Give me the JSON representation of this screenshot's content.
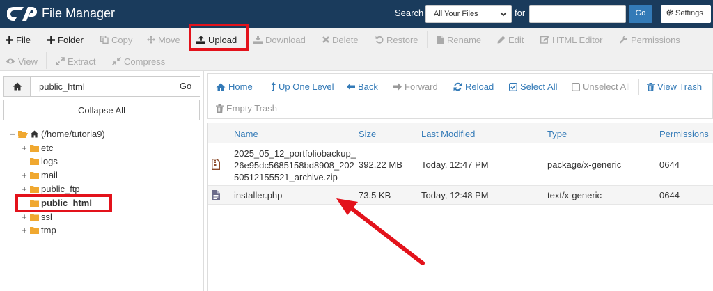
{
  "header": {
    "title": "File Manager",
    "search_label": "Search",
    "search_scope": "All Your Files",
    "for_label": "for",
    "search_value": "",
    "go_label": "Go",
    "settings_label": "Settings"
  },
  "toolbar": {
    "file": "File",
    "folder": "Folder",
    "copy": "Copy",
    "move": "Move",
    "upload": "Upload",
    "download": "Download",
    "delete": "Delete",
    "restore": "Restore",
    "rename": "Rename",
    "edit": "Edit",
    "html_editor": "HTML Editor",
    "permissions": "Permissions",
    "view": "View",
    "extract": "Extract",
    "compress": "Compress"
  },
  "sidebar": {
    "path_value": "public_html",
    "go_label": "Go",
    "collapse_label": "Collapse All",
    "root_label": "(/home/tutoria9)",
    "folders": [
      "etc",
      "logs",
      "mail",
      "public_ftp",
      "public_html",
      "ssl",
      "tmp"
    ]
  },
  "nav": {
    "home": "Home",
    "up_one_level": "Up One Level",
    "back": "Back",
    "forward": "Forward",
    "reload": "Reload",
    "select_all": "Select All",
    "unselect_all": "Unselect All",
    "view_trash": "View Trash",
    "empty_trash": "Empty Trash"
  },
  "table": {
    "columns": [
      "Name",
      "Size",
      "Last Modified",
      "Type",
      "Permissions"
    ],
    "rows": [
      {
        "name_lines": [
          "2025_05_12_portfoliobackup_",
          "26e95dc5685158bd8908_202",
          "50512155521_archive.zip"
        ],
        "size": "392.22 MB",
        "modified": "Today, 12:47 PM",
        "type": "package/x-generic",
        "perms": "0644"
      },
      {
        "name_lines": [
          "installer.php"
        ],
        "size": "73.5 KB",
        "modified": "Today, 12:48 PM",
        "type": "text/x-generic",
        "perms": "0644"
      }
    ]
  },
  "colors": {
    "header_bg": "#1a3b5c",
    "link": "#337ab7",
    "highlight": "#e3121b",
    "folder": "#f0a830"
  },
  "icons": [
    "cpanel-logo-icon",
    "settings-gear-icon",
    "plus-icon",
    "copy-icon",
    "move-icon",
    "upload-icon",
    "download-icon",
    "delete-x-icon",
    "restore-icon",
    "rename-file-icon",
    "edit-pencil-icon",
    "html-editor-icon",
    "wrench-icon",
    "eye-icon",
    "extract-icon",
    "compress-icon",
    "home-icon",
    "level-up-icon",
    "arrow-left-icon",
    "arrow-right-icon",
    "refresh-icon",
    "checkbox-checked-icon",
    "checkbox-empty-icon",
    "trash-icon",
    "folder-icon",
    "archive-file-icon",
    "text-file-icon"
  ]
}
